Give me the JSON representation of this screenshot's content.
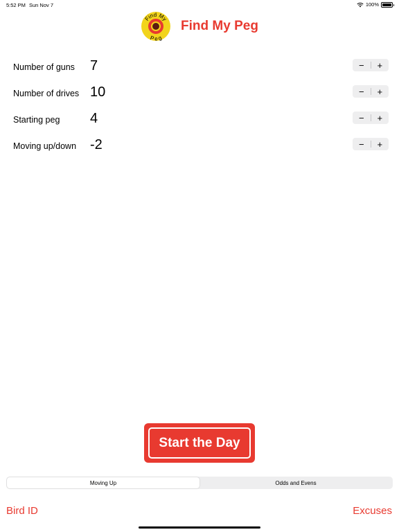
{
  "status_bar": {
    "time": "5:52 PM",
    "date": "Sun Nov 7",
    "battery": "100%",
    "battery_level": 1.0,
    "wifi_icon": "wifi-icon",
    "battery_icon": "battery-icon"
  },
  "header": {
    "title": "Find My Peg",
    "logo": {
      "text_top": "Find My",
      "text_bottom": "Peg",
      "icon": "find-my-peg-logo"
    }
  },
  "settings": [
    {
      "label": "Number of guns",
      "value": "7",
      "minus": "−",
      "plus": "+"
    },
    {
      "label": "Number of drives",
      "value": "10",
      "minus": "−",
      "plus": "+"
    },
    {
      "label": "Starting peg",
      "value": "4",
      "minus": "−",
      "plus": "+"
    },
    {
      "label": "Moving up/down",
      "value": "-2",
      "minus": "−",
      "plus": "+"
    }
  ],
  "start_button": {
    "label": "Start the Day"
  },
  "mode_selector": {
    "options": [
      "Moving Up",
      "Odds and Evens"
    ],
    "selected": "Moving Up"
  },
  "bottom_links": {
    "left": "Bird ID",
    "right": "Excuses"
  },
  "colors": {
    "accent": "#e83a30",
    "logo_yellow": "#f2d41c",
    "logo_ring": "#e83a30",
    "logo_center": "#5a1a10",
    "stepper_bg": "#eeeeef"
  }
}
